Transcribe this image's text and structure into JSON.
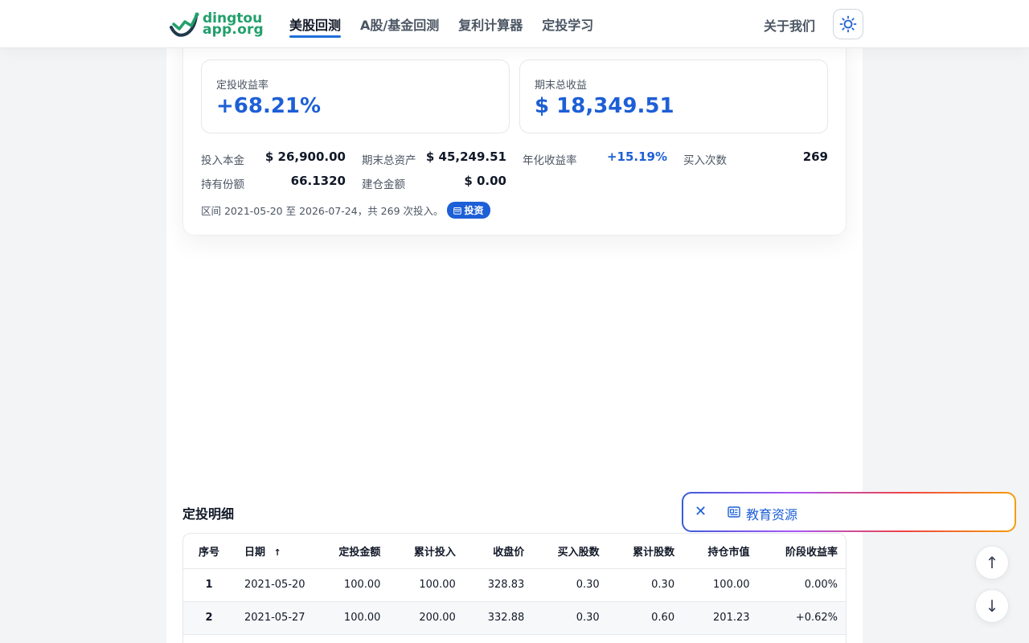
{
  "brand": {
    "line1": "dingtou",
    "line2_a": "app",
    "line2_b": ".org"
  },
  "nav": {
    "items": [
      {
        "label": "美股回测",
        "active": true
      },
      {
        "label": "A股/基金回测",
        "active": false
      },
      {
        "label": "复利计算器",
        "active": false
      },
      {
        "label": "定投学习",
        "active": false
      }
    ],
    "about": "关于我们"
  },
  "colors": {
    "accent": "#1d5fd6",
    "brand": "#22a06b"
  },
  "summary": {
    "return_rate": {
      "label": "定投收益率",
      "value": "+68.21%"
    },
    "total_profit": {
      "label": "期末总收益",
      "value": "$ 18,349.51"
    },
    "stats": [
      {
        "label": "投入本金",
        "value": "$ 26,900.00"
      },
      {
        "label": "期末总资产",
        "value": "$ 45,249.51"
      },
      {
        "label": "年化收益率",
        "value": "+15.19%"
      },
      {
        "label": "买入次数",
        "value": "269"
      },
      {
        "label": "持有份额",
        "value": "66.1320"
      },
      {
        "label": "建仓金额",
        "value": "$ 0.00"
      }
    ],
    "range_text": "区间 2021-05-20 至 2026-07-24，共 269 次投入。",
    "badge_label": "投资"
  },
  "details": {
    "title": "定投明细",
    "columns": [
      "序号",
      "日期",
      "定投金额",
      "累计投入",
      "收盘价",
      "买入股数",
      "累计股数",
      "持仓市值",
      "阶段收益率"
    ],
    "sort_indicator": "↑",
    "rows": [
      [
        "1",
        "2021-05-20",
        "100.00",
        "100.00",
        "328.83",
        "0.30",
        "0.30",
        "100.00",
        "0.00%"
      ],
      [
        "2",
        "2021-05-27",
        "100.00",
        "200.00",
        "332.88",
        "0.30",
        "0.60",
        "201.23",
        "+0.62%"
      ]
    ]
  },
  "education": {
    "close_glyph": "✕",
    "label": "教育资源"
  },
  "scroll": {
    "up": "↑",
    "down": "↓"
  }
}
